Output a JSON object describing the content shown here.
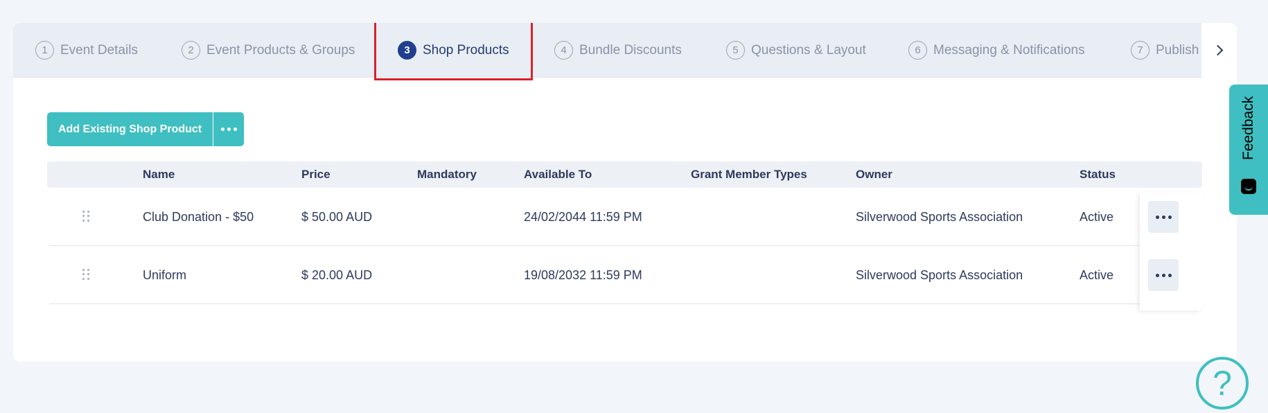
{
  "tabs": [
    {
      "number": "1",
      "label": "Event Details"
    },
    {
      "number": "2",
      "label": "Event Products & Groups"
    },
    {
      "number": "3",
      "label": "Shop Products",
      "active": true
    },
    {
      "number": "4",
      "label": "Bundle Discounts"
    },
    {
      "number": "5",
      "label": "Questions & Layout"
    },
    {
      "number": "6",
      "label": "Messaging & Notifications"
    },
    {
      "number": "7",
      "label": "Publish"
    }
  ],
  "toolbar": {
    "add_label": "Add Existing Shop Product",
    "more_icon": "more-horizontal-icon"
  },
  "table": {
    "columns": [
      "Name",
      "Price",
      "Mandatory",
      "Available To",
      "Grant Member Types",
      "Owner",
      "Status"
    ],
    "rows": [
      {
        "name": "Club Donation - $50",
        "price": "$ 50.00 AUD",
        "mandatory": "",
        "available_to": "24/02/2044 11:59 PM",
        "grant_member_types": "",
        "owner": "Silverwood Sports Association",
        "status": "Active"
      },
      {
        "name": "Uniform",
        "price": "$ 20.00 AUD",
        "mandatory": "",
        "available_to": "19/08/2032 11:59 PM",
        "grant_member_types": "",
        "owner": "Silverwood Sports Association",
        "status": "Active"
      }
    ]
  },
  "feedback": {
    "label": "Feedback"
  },
  "help": {
    "label": "?"
  },
  "colors": {
    "accent": "#3fbfc1",
    "active_tab": "#213f8f",
    "highlight_border": "#d9212a",
    "text": "#2d3a5c"
  }
}
